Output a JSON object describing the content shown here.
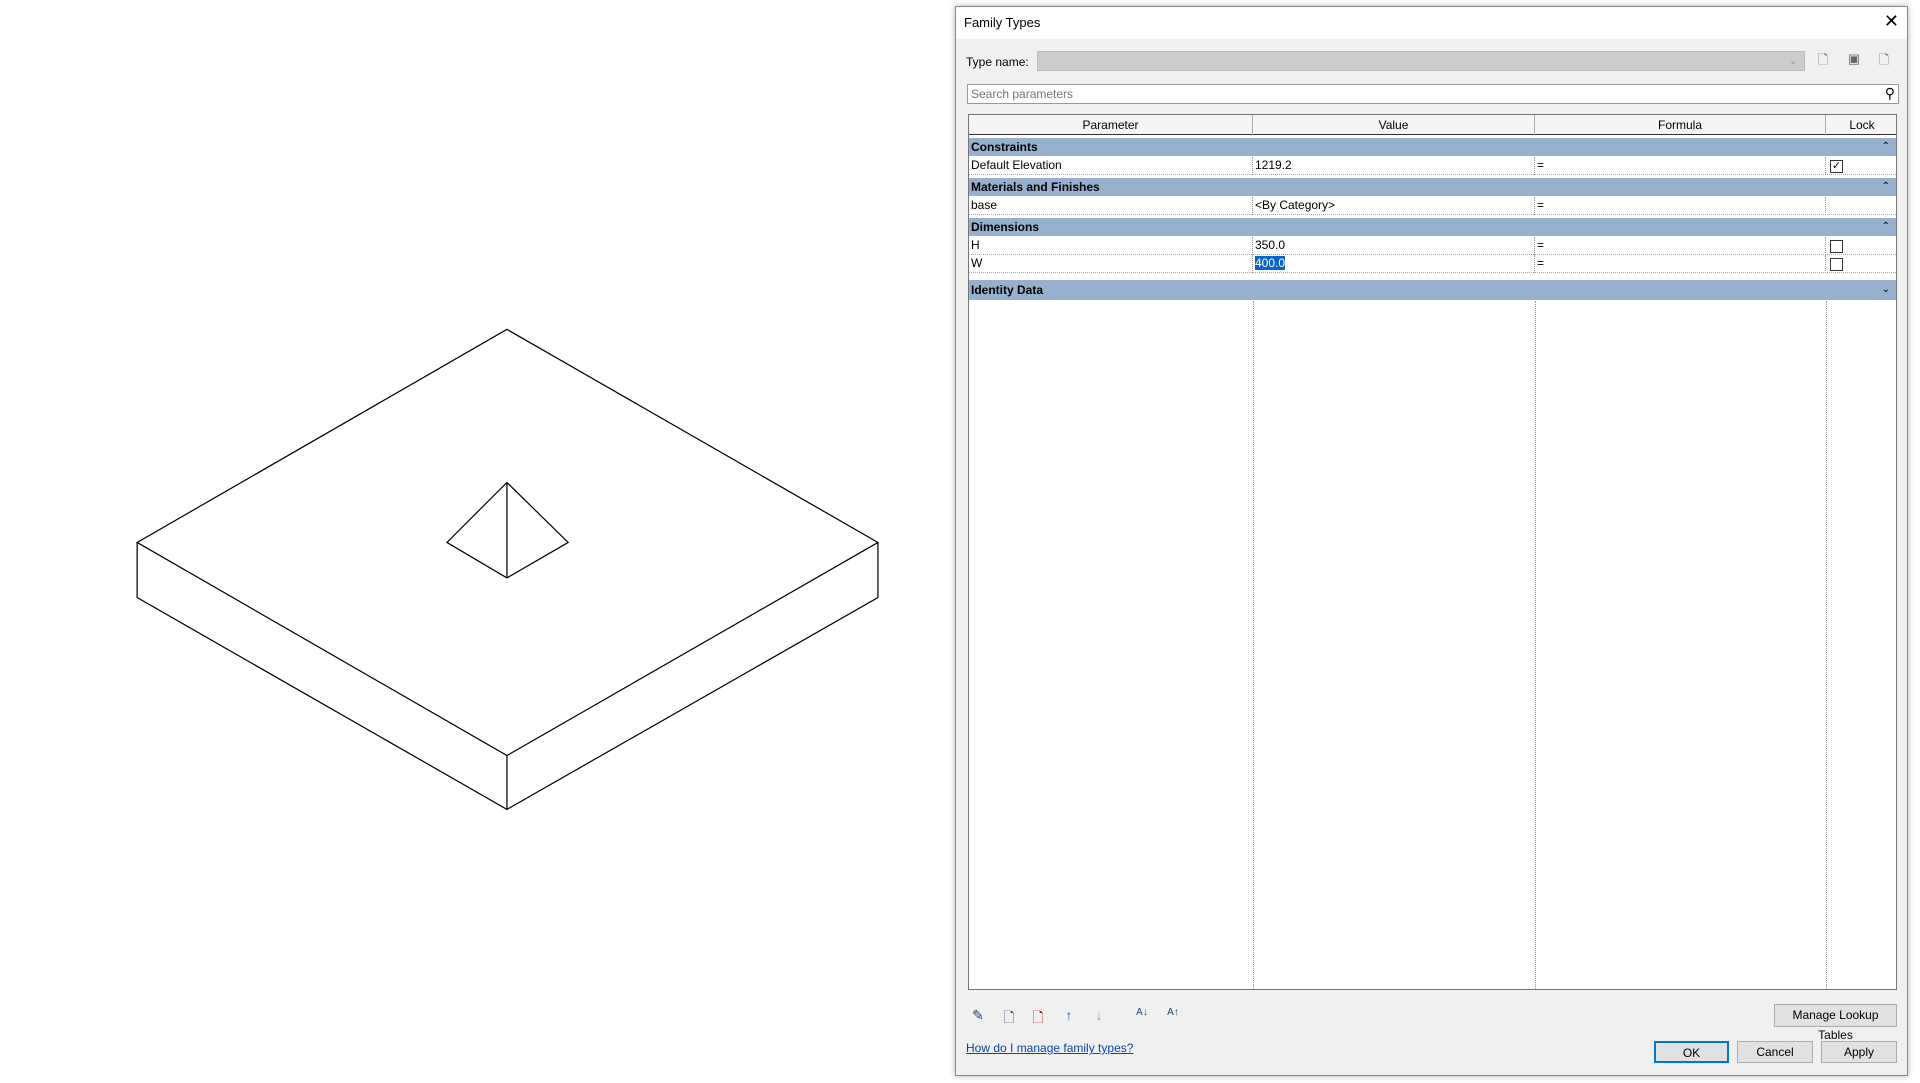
{
  "dialog": {
    "title": "Family Types",
    "close_icon": "close-icon"
  },
  "type_name": {
    "label": "Type name:",
    "value": ""
  },
  "search": {
    "placeholder": "Search parameters"
  },
  "columns": [
    "Parameter",
    "Value",
    "Formula",
    "Lock"
  ],
  "groups": [
    {
      "name": "Constraints",
      "rows": [
        {
          "param": "Default Elevation",
          "value": "1219.2",
          "formula": "=",
          "lock": true
        }
      ]
    },
    {
      "name": "Materials and Finishes",
      "rows": [
        {
          "param": "base",
          "value": "<By Category>",
          "formula": "=",
          "lock": null
        }
      ]
    },
    {
      "name": "Dimensions",
      "rows": [
        {
          "param": "H",
          "value": "350.0",
          "formula": "=",
          "lock": false
        },
        {
          "param": "W",
          "value": "400.0",
          "formula": "=",
          "lock": false,
          "selected": true
        }
      ]
    },
    {
      "name": "Identity Data",
      "collapsed": true
    }
  ],
  "buttons": {
    "manage_lookup": "Manage Lookup Tables",
    "ok": "OK",
    "cancel": "Cancel",
    "apply": "Apply"
  },
  "help_link": "How do I manage family types?"
}
